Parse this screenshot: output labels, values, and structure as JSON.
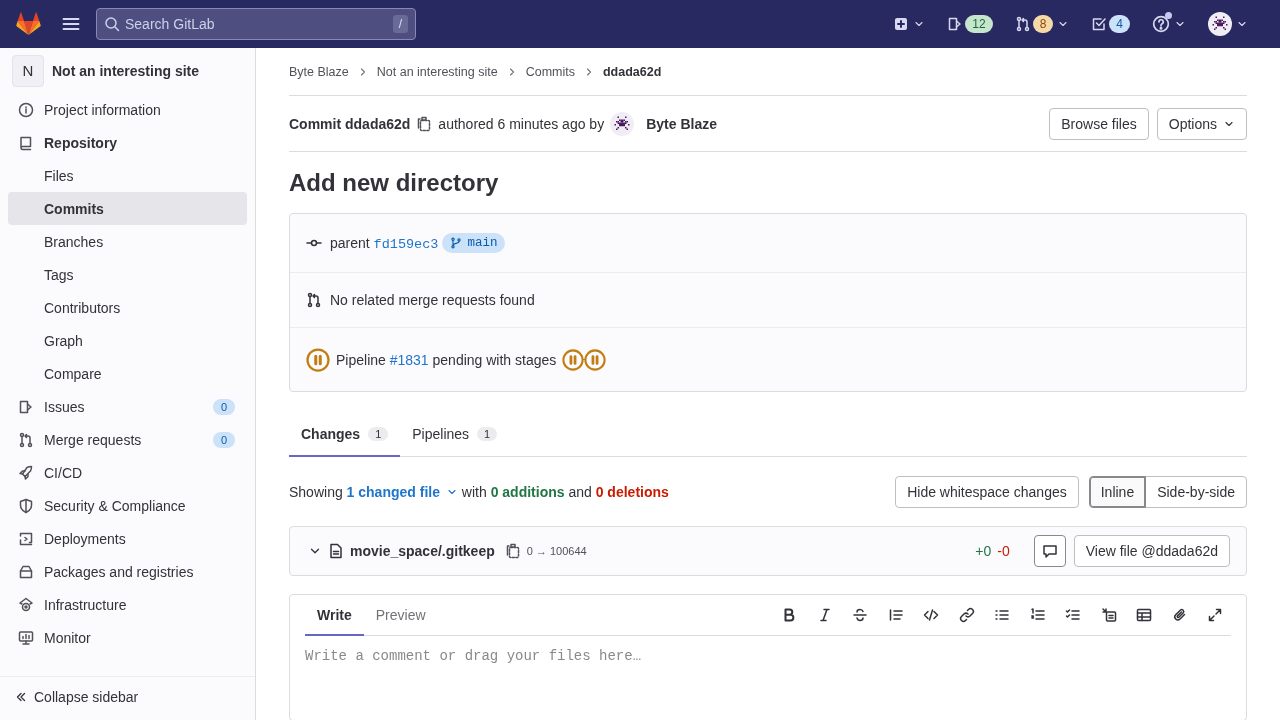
{
  "topbar": {
    "search_placeholder": "Search GitLab",
    "shortcut": "/",
    "counters": [
      {
        "kind": "issues",
        "count": "12"
      },
      {
        "kind": "merge_requests",
        "count": "8"
      },
      {
        "kind": "todos",
        "count": "4"
      }
    ]
  },
  "sidebar": {
    "project": {
      "initial": "N",
      "name": "Not an interesting site"
    },
    "items": [
      {
        "label": "Project information",
        "expanded": false
      },
      {
        "label": "Repository",
        "expanded": true,
        "children": [
          {
            "label": "Files",
            "selected": false
          },
          {
            "label": "Commits",
            "selected": true
          },
          {
            "label": "Branches",
            "selected": false
          },
          {
            "label": "Tags",
            "selected": false
          },
          {
            "label": "Contributors",
            "selected": false
          },
          {
            "label": "Graph",
            "selected": false
          },
          {
            "label": "Compare",
            "selected": false
          }
        ]
      },
      {
        "label": "Issues",
        "expanded": false,
        "count": "0"
      },
      {
        "label": "Merge requests",
        "expanded": false,
        "count": "0"
      },
      {
        "label": "CI/CD",
        "expanded": false
      },
      {
        "label": "Security & Compliance",
        "expanded": false
      },
      {
        "label": "Deployments",
        "expanded": false
      },
      {
        "label": "Packages and registries",
        "expanded": false
      },
      {
        "label": "Infrastructure",
        "expanded": false
      },
      {
        "label": "Monitor",
        "expanded": false
      }
    ],
    "collapse": "Collapse sidebar"
  },
  "breadcrumbs": [
    "Byte Blaze",
    "Not an interesting site",
    "Commits",
    "ddada62d"
  ],
  "commit": {
    "label": "Commit ddada62d",
    "authored": "authored 6 minutes ago by",
    "author": "Byte Blaze",
    "browse": "Browse files",
    "options": "Options",
    "title": "Add new directory",
    "parent_label": "parent",
    "parent": "fd159ec3",
    "branch": "main",
    "merge_requests": "No related merge requests found",
    "pipeline": {
      "color": "#c17d10",
      "label": "Pipeline",
      "id": "#1831",
      "text": "pending with stages",
      "stages": [
        {
          "color": "#c17d10"
        },
        {
          "color": "#c17d10"
        }
      ]
    }
  },
  "tabs": [
    {
      "label": "Changes",
      "count": "1",
      "selected": true
    },
    {
      "label": "Pipelines",
      "count": "1",
      "selected": false
    }
  ],
  "summary": {
    "prefix": "Showing",
    "files": "1 changed file",
    "with": "with",
    "additions": "0 additions",
    "and": "and",
    "deletions": "0 deletions"
  },
  "whitespace_button": "Hide whitespace changes",
  "view_modes": [
    {
      "label": "Inline",
      "selected": true
    },
    {
      "label": "Side-by-side",
      "selected": false
    }
  ],
  "file": {
    "expanded": true,
    "path": "movie_space/.gitkeep",
    "mode": "0 → 100644",
    "added": "+0",
    "removed": "-0",
    "view_button": "View file @ddada62d"
  },
  "editor": {
    "tabs": [
      {
        "label": "Write",
        "selected": true
      },
      {
        "label": "Preview",
        "selected": false
      }
    ],
    "placeholder": "Write a comment or drag your files here…"
  }
}
